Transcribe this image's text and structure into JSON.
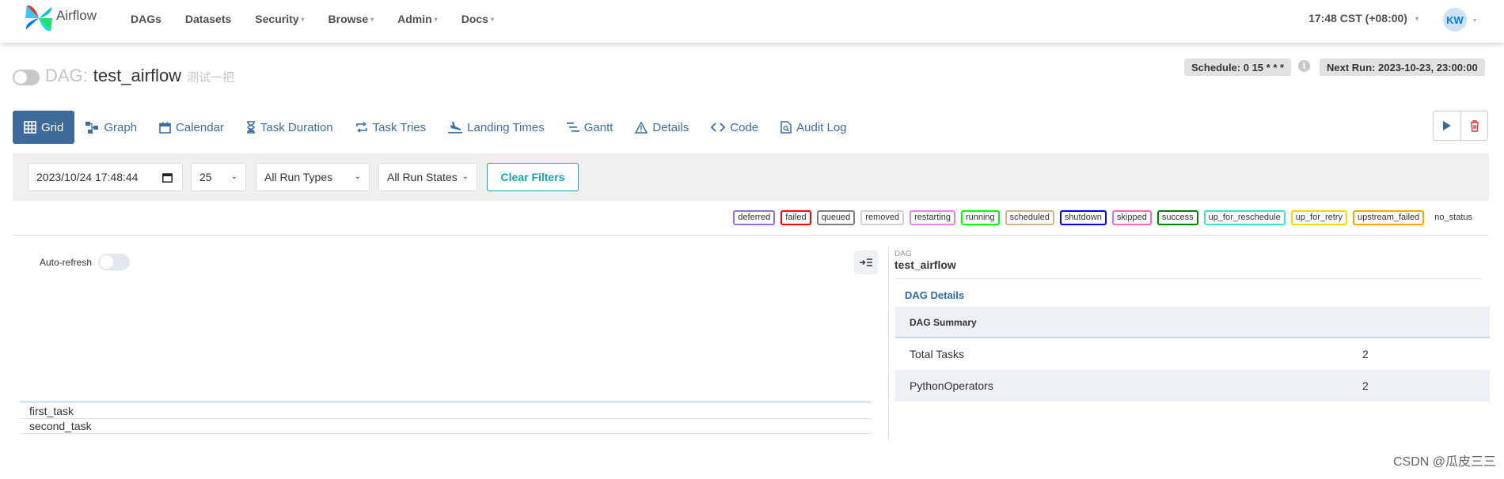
{
  "navbar": {
    "brand": "Airflow",
    "items": [
      {
        "label": "DAGs",
        "dropdown": false
      },
      {
        "label": "Datasets",
        "dropdown": false
      },
      {
        "label": "Security",
        "dropdown": true
      },
      {
        "label": "Browse",
        "dropdown": true
      },
      {
        "label": "Admin",
        "dropdown": true
      },
      {
        "label": "Docs",
        "dropdown": true
      }
    ],
    "time": "17:48 CST (+08:00)",
    "user_initials": "KW"
  },
  "dag": {
    "prefix": "DAG:",
    "id": "test_airflow",
    "description": "测试一把",
    "schedule": "Schedule: 0 15 * * *",
    "next_run": "Next Run: 2023-10-23, 23:00:00"
  },
  "tabs": [
    {
      "label": "Grid",
      "icon": "grid-icon",
      "active": true
    },
    {
      "label": "Graph",
      "icon": "graph-icon"
    },
    {
      "label": "Calendar",
      "icon": "calendar-icon"
    },
    {
      "label": "Task Duration",
      "icon": "hourglass-icon"
    },
    {
      "label": "Task Tries",
      "icon": "retry-icon"
    },
    {
      "label": "Landing Times",
      "icon": "plane-landing-icon"
    },
    {
      "label": "Gantt",
      "icon": "gantt-icon"
    },
    {
      "label": "Details",
      "icon": "warning-triangle-icon"
    },
    {
      "label": "Code",
      "icon": "code-icon"
    },
    {
      "label": "Audit Log",
      "icon": "file-search-icon"
    }
  ],
  "filters": {
    "base_date": "2023/10/24  17:48:44",
    "num_runs": "25",
    "run_type": "All Run Types",
    "run_state": "All Run States",
    "clear_label": "Clear Filters"
  },
  "legend": [
    {
      "label": "deferred",
      "color": "#9370db"
    },
    {
      "label": "failed",
      "color": "#ff0000"
    },
    {
      "label": "queued",
      "color": "#808080"
    },
    {
      "label": "removed",
      "color": "#d3d3d3"
    },
    {
      "label": "restarting",
      "color": "#ee82ee"
    },
    {
      "label": "running",
      "color": "#00ff00"
    },
    {
      "label": "scheduled",
      "color": "#d2b48c"
    },
    {
      "label": "shutdown",
      "color": "#0000ff"
    },
    {
      "label": "skipped",
      "color": "#ff69b4"
    },
    {
      "label": "success",
      "color": "#008000"
    },
    {
      "label": "up_for_reschedule",
      "color": "#40e0d0"
    },
    {
      "label": "up_for_retry",
      "color": "#ffd700"
    },
    {
      "label": "upstream_failed",
      "color": "#ffa500"
    },
    {
      "label": "no_status",
      "color": "transparent"
    }
  ],
  "grid": {
    "auto_refresh_label": "Auto-refresh",
    "tasks": [
      "first_task",
      "second_task"
    ]
  },
  "details": {
    "breadcrumb_label": "DAG",
    "breadcrumb_value": "test_airflow",
    "tab": "DAG Details",
    "summary_title": "DAG Summary",
    "rows": [
      {
        "key": "Total Tasks",
        "value": "2"
      },
      {
        "key": "PythonOperators",
        "value": "2"
      }
    ]
  },
  "watermark": "CSDN @瓜皮三三"
}
